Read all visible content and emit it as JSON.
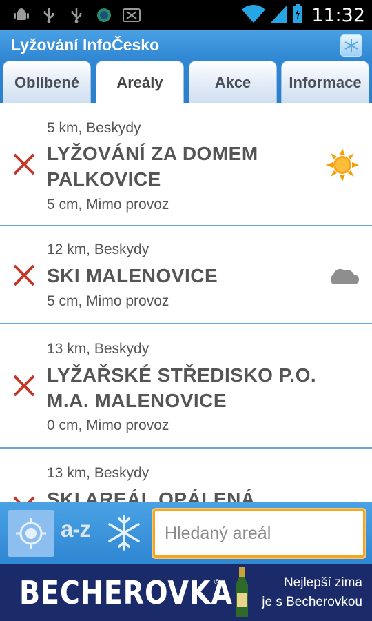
{
  "status_bar": {
    "time": "11:32",
    "icons": [
      "android-debug-icon",
      "usb-icon",
      "usb-icon",
      "app-notification-icon",
      "sd-card-icon",
      "wifi-icon",
      "signal-icon",
      "battery-icon"
    ]
  },
  "app": {
    "title": "Lyžování InfoČesko"
  },
  "tabs": [
    {
      "label": "Oblíbené",
      "active": false
    },
    {
      "label": "Areály",
      "active": true
    },
    {
      "label": "Akce",
      "active": false
    },
    {
      "label": "Informace",
      "active": false
    }
  ],
  "resorts": [
    {
      "distance_region": "5 km, Beskydy",
      "name_line1": "LYŽOVÁNÍ ZA DOMEM",
      "name_line2": "PALKOVICE",
      "snow_status": "5 cm, Mimo provoz",
      "weather": "sun-icon",
      "open": false
    },
    {
      "distance_region": "12 km, Beskydy",
      "name_line1": "SKI MALENOVICE",
      "name_line2": "",
      "snow_status": "5 cm, Mimo provoz",
      "weather": "cloud-icon",
      "open": false
    },
    {
      "distance_region": "13 km, Beskydy",
      "name_line1": "LYŽAŘSKÉ STŘEDISKO P.O.",
      "name_line2": "M.A. MALENOVICE",
      "snow_status": "0 cm, Mimo provoz",
      "weather": "",
      "open": false
    },
    {
      "distance_region": "13 km, Beskydy",
      "name_line1": "SKI AREÁL OPÁLENÁ",
      "name_line2": "",
      "snow_status": "",
      "weather": "",
      "open": false
    }
  ],
  "toolbar": {
    "az_label": "a-z",
    "search_placeholder": "Hledaný areál"
  },
  "ad": {
    "brand": "BECHEROVKA",
    "registered": "®",
    "slogan_line1": "Nejlepší zima",
    "slogan_line2": "je s Becherovkou"
  },
  "colors": {
    "accent_blue": "#2f86d2",
    "closed_x": "#c0392b",
    "search_border": "#f5a623",
    "ad_background": "#1b2a68"
  }
}
